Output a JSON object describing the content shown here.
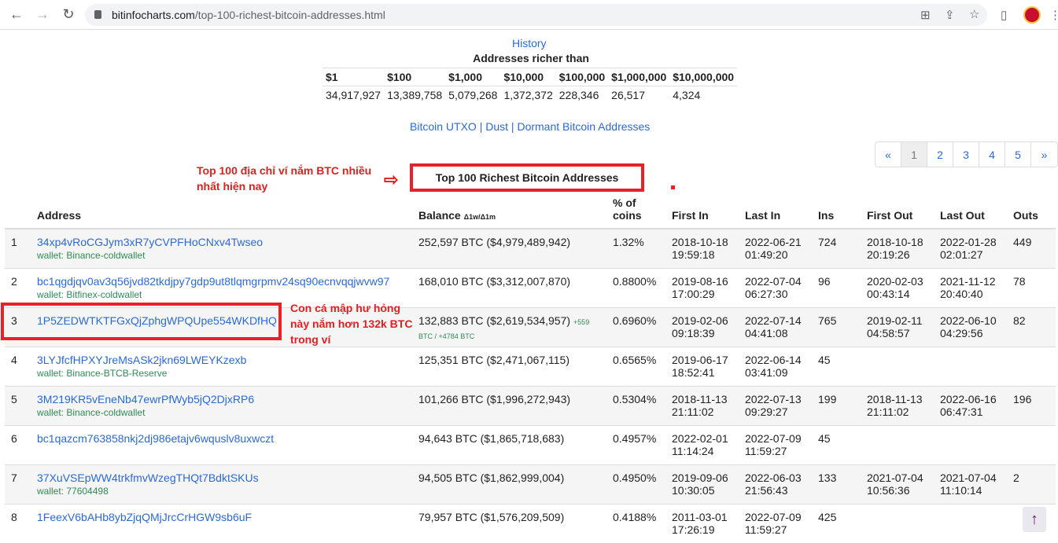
{
  "browser": {
    "url_host": "bitinfocharts.com",
    "url_path": "/top-100-richest-bitcoin-addresses.html"
  },
  "history_link": "History",
  "rich": {
    "title": "Addresses richer than",
    "headers": [
      "$1",
      "$100",
      "$1,000",
      "$10,000",
      "$100,000",
      "$1,000,000",
      "$10,000,000"
    ],
    "values": [
      "34,917,927",
      "13,389,758",
      "5,079,268",
      "1,372,372",
      "228,346",
      "26,517",
      "4,324"
    ]
  },
  "links": {
    "utxo": "Bitcoin UTXO",
    "sep1": " | ",
    "dust": "Dust",
    "sep2": " | ",
    "dormant": "Dormant Bitcoin Addresses"
  },
  "pager": {
    "prev": "«",
    "pages": [
      "1",
      "2",
      "3",
      "4",
      "5"
    ],
    "next": "»",
    "active": "1"
  },
  "annotation1": "Top 100 địa chỉ ví nắm BTC nhiều nhất hiện nay",
  "annotation2": "Con cá mập hư hỏng này nắm hơn 132k BTC trong ví",
  "table_title": "Top 100 Richest Bitcoin Addresses",
  "columns": {
    "address": "Address",
    "balance": "Balance",
    "balance_sub": "Δ1w/Δ1m",
    "pct": "% of coins",
    "first_in": "First In",
    "last_in": "Last In",
    "ins": "Ins",
    "first_out": "First Out",
    "last_out": "Last Out",
    "outs": "Outs"
  },
  "rows": [
    {
      "rank": "1",
      "address": "34xp4vRoCGJym3xR7yCVPFHoCNxv4Twseo",
      "wallet": "wallet: Binance-coldwallet",
      "balance": "252,597 BTC ($4,979,489,942)",
      "change": "",
      "pct": "1.32%",
      "first_in": [
        "2018-10-18",
        "19:59:18"
      ],
      "last_in": [
        "2022-06-21",
        "01:49:20"
      ],
      "ins": "724",
      "first_out": [
        "2018-10-18",
        "20:19:26"
      ],
      "last_out": [
        "2022-01-28",
        "02:01:27"
      ],
      "outs": "449"
    },
    {
      "rank": "2",
      "address": "bc1qgdjqv0av3q56jvd82tkdjpy7gdp9ut8tlqmgrpmv24sq90ecnvqqjwvw97",
      "wallet": "wallet: Bitfinex-coldwallet",
      "balance": "168,010 BTC ($3,312,007,870)",
      "change": "",
      "pct": "0.8800%",
      "first_in": [
        "2019-08-16",
        "17:00:29"
      ],
      "last_in": [
        "2022-07-04",
        "06:27:30"
      ],
      "ins": "96",
      "first_out": [
        "2020-02-03",
        "00:43:14"
      ],
      "last_out": [
        "2021-11-12",
        "20:40:40"
      ],
      "outs": "78"
    },
    {
      "rank": "3",
      "address": "1P5ZEDWTKTFGxQjZphgWPQUpe554WKDfHQ",
      "wallet": "",
      "balance": "132,883 BTC ($2,619,534,957)",
      "change": "+559 BTC / +4784 BTC",
      "pct": "0.6960%",
      "first_in": [
        "2019-02-06",
        "09:18:39"
      ],
      "last_in": [
        "2022-07-14",
        "04:41:08"
      ],
      "ins": "765",
      "first_out": [
        "2019-02-11",
        "04:58:57"
      ],
      "last_out": [
        "2022-06-10",
        "04:29:56"
      ],
      "outs": "82"
    },
    {
      "rank": "4",
      "address": "3LYJfcfHPXYJreMsASk2jkn69LWEYKzexb",
      "wallet": "wallet: Binance-BTCB-Reserve",
      "balance": "125,351 BTC ($2,471,067,115)",
      "change": "",
      "pct": "0.6565%",
      "first_in": [
        "2019-06-17",
        "18:52:41"
      ],
      "last_in": [
        "2022-06-14",
        "03:41:09"
      ],
      "ins": "45",
      "first_out": [
        "",
        ""
      ],
      "last_out": [
        "",
        ""
      ],
      "outs": ""
    },
    {
      "rank": "5",
      "address": "3M219KR5vEneNb47ewrPfWyb5jQ2DjxRP6",
      "wallet": "wallet: Binance-coldwallet",
      "balance": "101,266 BTC ($1,996,272,943)",
      "change": "",
      "pct": "0.5304%",
      "first_in": [
        "2018-11-13",
        "21:11:02"
      ],
      "last_in": [
        "2022-07-13",
        "09:29:27"
      ],
      "ins": "199",
      "first_out": [
        "2018-11-13",
        "21:11:02"
      ],
      "last_out": [
        "2022-06-16",
        "06:47:31"
      ],
      "outs": "196"
    },
    {
      "rank": "6",
      "address": "bc1qazcm763858nkj2dj986etajv6wquslv8uxwczt",
      "wallet": "",
      "balance": "94,643 BTC ($1,865,718,683)",
      "change": "",
      "pct": "0.4957%",
      "first_in": [
        "2022-02-01",
        "11:14:24"
      ],
      "last_in": [
        "2022-07-09",
        "11:59:27"
      ],
      "ins": "45",
      "first_out": [
        "",
        ""
      ],
      "last_out": [
        "",
        ""
      ],
      "outs": ""
    },
    {
      "rank": "7",
      "address": "37XuVSEpWW4trkfmvWzegTHQt7BdktSKUs",
      "wallet": "wallet: 77604498",
      "balance": "94,505 BTC ($1,862,999,004)",
      "change": "",
      "pct": "0.4950%",
      "first_in": [
        "2019-09-06",
        "10:30:05"
      ],
      "last_in": [
        "2022-06-03",
        "21:56:43"
      ],
      "ins": "133",
      "first_out": [
        "2021-07-04",
        "10:56:36"
      ],
      "last_out": [
        "2021-07-04",
        "11:10:14"
      ],
      "outs": "2"
    },
    {
      "rank": "8",
      "address": "1FeexV6bAHb8ybZjqQMjJrcCrHGW9sb6uF",
      "wallet": "",
      "balance": "79,957 BTC ($1,576,209,509)",
      "change": "",
      "pct": "0.4188%",
      "first_in": [
        "2011-03-01",
        "17:26:19"
      ],
      "last_in": [
        "2022-07-09",
        "11:59:27"
      ],
      "ins": "425",
      "first_out": [
        "",
        ""
      ],
      "last_out": [
        "",
        ""
      ],
      "outs": ""
    }
  ],
  "scroll_top": "↑"
}
